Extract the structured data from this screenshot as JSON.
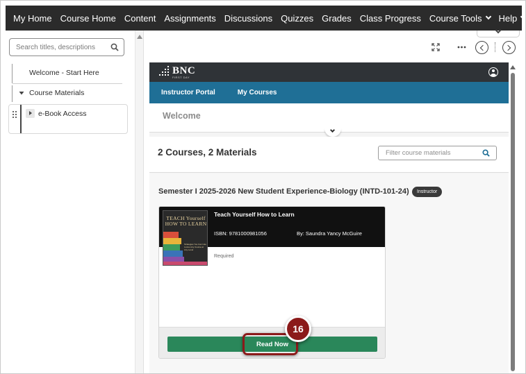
{
  "topnav": {
    "items": [
      {
        "label": "My Home"
      },
      {
        "label": "Course Home"
      },
      {
        "label": "Content"
      },
      {
        "label": "Assignments"
      },
      {
        "label": "Discussions"
      },
      {
        "label": "Quizzes"
      },
      {
        "label": "Grades"
      },
      {
        "label": "Class Progress"
      },
      {
        "label": "Course Tools"
      },
      {
        "label": "Help"
      }
    ]
  },
  "sidebar": {
    "search_placeholder": "Search titles, descriptions",
    "items": [
      {
        "label": "Welcome - Start Here"
      },
      {
        "label": "Course Materials"
      },
      {
        "label": "e-Book Access"
      }
    ]
  },
  "embed": {
    "logo": "BNC",
    "logo_sub": "FIRST DAY",
    "portal_links": [
      "Instructor Portal",
      "My Courses"
    ],
    "welcome_title": "Welcome",
    "course_count": "2 Courses,  2 Materials",
    "filter_placeholder": "Filter course materials",
    "course": {
      "title": "Semester I 2025-2026 New Student Experience-Biology (INTD-101-24)",
      "role_badge": "Instructor"
    },
    "material": {
      "title": "Teach Yourself How to Learn",
      "isbn": "ISBN: 9781000981056",
      "author": "By: Saundra Yancy McGuire",
      "status": "Required",
      "cover_title": "TEACH Yourself HOW TO LEARN",
      "cover_sub": "Strategies You Can Use to Ace Any Course at Any Level",
      "button": "Read Now"
    }
  },
  "annotation": {
    "step": "16"
  },
  "colors": {
    "nav_bg": "#2b2b2b",
    "portal_bar": "#1f6f96",
    "read_button": "#2a875a",
    "annotation": "#8b1a1a"
  }
}
